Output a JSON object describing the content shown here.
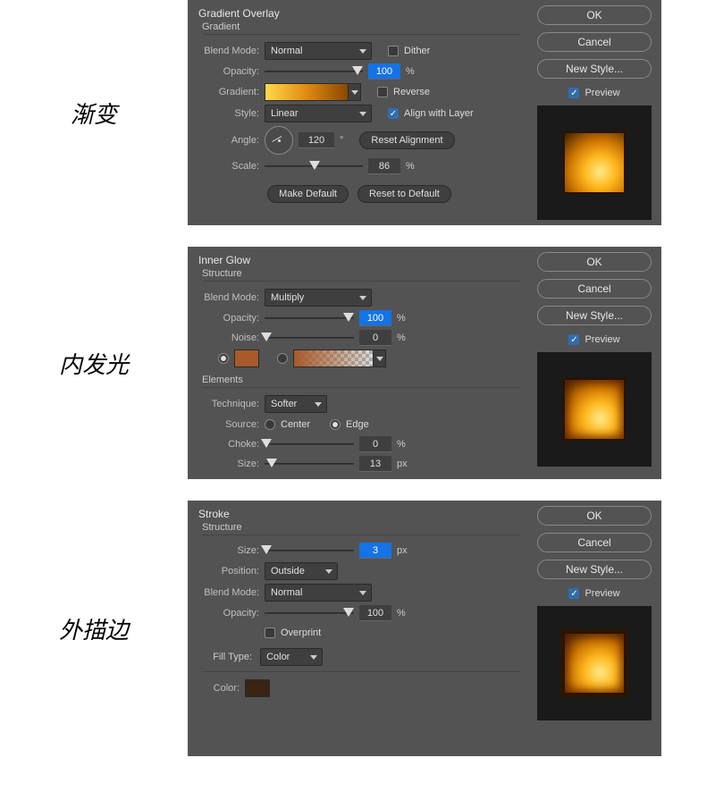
{
  "sections": {
    "gradient": {
      "cn_label": "渐变",
      "title": "Gradient Overlay",
      "sub": "Gradient",
      "labels": {
        "blend_mode": "Blend Mode:",
        "opacity": "Opacity:",
        "gradient": "Gradient:",
        "style": "Style:",
        "angle": "Angle:",
        "scale": "Scale:",
        "dither": "Dither",
        "reverse": "Reverse",
        "align": "Align with Layer",
        "reset_align": "Reset Alignment",
        "make_default": "Make Default",
        "reset_default": "Reset to Default",
        "deg": "°",
        "pct": "%"
      },
      "values": {
        "blend_mode": "Normal",
        "opacity": "100",
        "style": "Linear",
        "angle": "120",
        "scale": "86",
        "dither": false,
        "reverse": false,
        "align": true
      }
    },
    "innerglow": {
      "cn_label": "内发光",
      "title": "Inner Glow",
      "sub_structure": "Structure",
      "sub_elements": "Elements",
      "labels": {
        "blend_mode": "Blend Mode:",
        "opacity": "Opacity:",
        "noise": "Noise:",
        "technique": "Technique:",
        "source": "Source:",
        "center": "Center",
        "edge": "Edge",
        "choke": "Choke:",
        "size": "Size:",
        "pct": "%",
        "px": "px"
      },
      "values": {
        "blend_mode": "Multiply",
        "opacity": "100",
        "noise": "0",
        "technique": "Softer",
        "source": "edge",
        "choke": "0",
        "size": "13",
        "color": "#a85a28",
        "color_radio": true,
        "gradient_radio": false
      }
    },
    "stroke": {
      "cn_label": "外描边",
      "title": "Stroke",
      "sub": "Structure",
      "labels": {
        "size": "Size:",
        "position": "Position:",
        "blend_mode": "Blend Mode:",
        "opacity": "Opacity:",
        "overprint": "Overprint",
        "fill_type": "Fill Type:",
        "color": "Color:",
        "px": "px",
        "pct": "%"
      },
      "values": {
        "size": "3",
        "position": "Outside",
        "blend_mode": "Normal",
        "opacity": "100",
        "overprint": false,
        "fill_type": "Color",
        "color": "#3b2413"
      }
    }
  },
  "sidebar": {
    "ok": "OK",
    "cancel": "Cancel",
    "new_style": "New Style...",
    "preview": "Preview"
  }
}
